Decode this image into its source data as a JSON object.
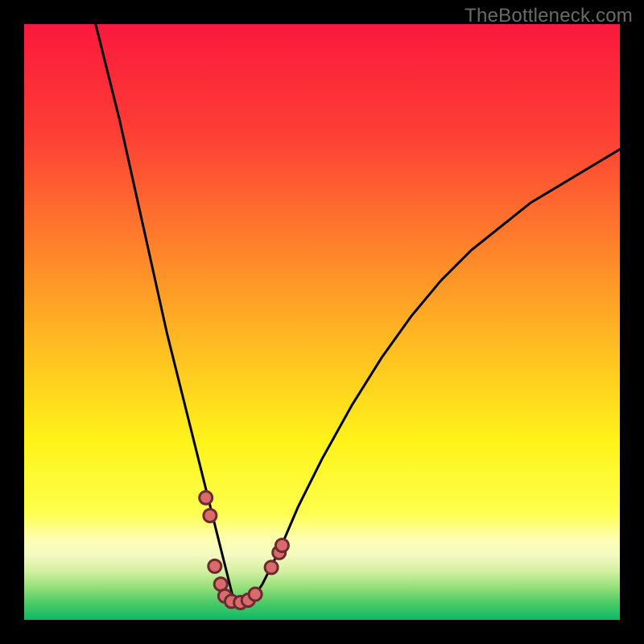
{
  "watermark": "TheBottleneck.com",
  "chart_data": {
    "type": "line",
    "title": "",
    "xlabel": "",
    "ylabel": "",
    "xlim": [
      0,
      100
    ],
    "ylim": [
      0,
      100
    ],
    "curve": {
      "x": [
        12,
        14,
        16,
        18,
        20,
        22,
        24,
        26,
        28,
        30,
        31,
        32,
        33,
        34,
        35,
        36,
        38,
        40,
        43,
        46,
        50,
        55,
        60,
        65,
        70,
        75,
        80,
        85,
        90,
        95,
        100
      ],
      "y": [
        100,
        92,
        84,
        75,
        66,
        57,
        48,
        40,
        32,
        24,
        20,
        16,
        12,
        8,
        4,
        2,
        3,
        6,
        12,
        19,
        27,
        36,
        44,
        51,
        57,
        62,
        66,
        70,
        73,
        76,
        79
      ]
    },
    "green_band": {
      "y0": 0,
      "y1": 5
    },
    "markers": [
      {
        "x": 30.5,
        "y": 20.5
      },
      {
        "x": 31.2,
        "y": 17.5
      },
      {
        "x": 32.0,
        "y": 9.0
      },
      {
        "x": 33.0,
        "y": 6.0
      },
      {
        "x": 33.7,
        "y": 4.0
      },
      {
        "x": 34.8,
        "y": 3.1
      },
      {
        "x": 36.3,
        "y": 2.9
      },
      {
        "x": 37.6,
        "y": 3.3
      },
      {
        "x": 38.8,
        "y": 4.3
      },
      {
        "x": 41.5,
        "y": 8.8
      },
      {
        "x": 42.8,
        "y": 11.3
      },
      {
        "x": 43.3,
        "y": 12.5
      }
    ],
    "marker_style": {
      "radius": 8,
      "fill": "#d96a6d",
      "stroke": "#6b2b2d",
      "stroke_width": 3
    },
    "background_gradient": [
      {
        "stop": 0.0,
        "color": "#fb193d"
      },
      {
        "stop": 0.18,
        "color": "#fd3d35"
      },
      {
        "stop": 0.35,
        "color": "#fe792c"
      },
      {
        "stop": 0.55,
        "color": "#ffc021"
      },
      {
        "stop": 0.7,
        "color": "#fff319"
      },
      {
        "stop": 0.82,
        "color": "#fdff4d"
      },
      {
        "stop": 0.865,
        "color": "#fefeb3"
      },
      {
        "stop": 0.892,
        "color": "#f3fac1"
      },
      {
        "stop": 0.918,
        "color": "#d5f0a3"
      },
      {
        "stop": 0.945,
        "color": "#96df7a"
      },
      {
        "stop": 0.972,
        "color": "#4bca67"
      },
      {
        "stop": 1.0,
        "color": "#0eb868"
      }
    ]
  }
}
